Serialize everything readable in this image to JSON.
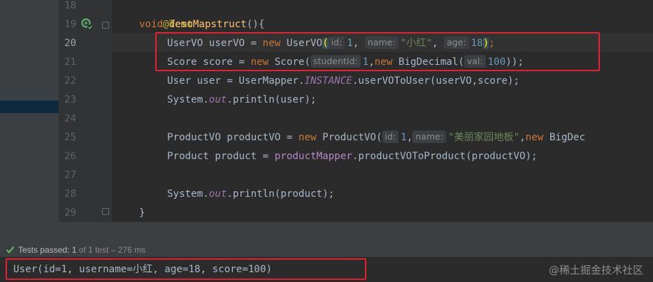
{
  "editor": {
    "lines": [
      {
        "n": "18"
      },
      {
        "n": "19"
      },
      {
        "n": "20"
      },
      {
        "n": "21"
      },
      {
        "n": "22"
      },
      {
        "n": "23"
      },
      {
        "n": "24"
      },
      {
        "n": "25"
      },
      {
        "n": "26"
      },
      {
        "n": "27"
      },
      {
        "n": "28"
      },
      {
        "n": "29"
      }
    ],
    "code": {
      "l18": {
        "annotation": "@Test"
      },
      "l19": {
        "kw": "void",
        "method": "demoMapstruct",
        "rest": "(){"
      },
      "l20": {
        "a": "UserVO userVO = ",
        "kw": "new",
        "b": " UserVO",
        "paren": "(",
        "hint1": "id:",
        "v1": "1",
        "c1": ", ",
        "hint2": "name:",
        "v2": "\"小红\"",
        "c2": ", ",
        "hint3": "age:",
        "v3": "18",
        "close": ")",
        "end": ";"
      },
      "l21": {
        "a": "Score score = ",
        "kw": "new",
        "b": " Score(",
        "hint1": "studentId:",
        "v1": "1",
        "c1": ",",
        "kw2": "new",
        "b2": " BigDecimal(",
        "hint2": "val:",
        "v2": "100",
        "end": "));"
      },
      "l22": {
        "a": "User user = UserMapper.",
        "instance": "INSTANCE",
        "b": ".userVOToUser(userVO,score);"
      },
      "l23": {
        "a": "System.",
        "out": "out",
        "b": ".println(user);"
      },
      "l25": {
        "a": "ProductVO productVO = ",
        "kw": "new",
        "b": " ProductVO(",
        "hint1": "id:",
        "v1": "1",
        "c1": ",",
        "hint2": "name:",
        "v2": "\"美丽家园地板\"",
        "c2": ",",
        "kw2": "new",
        "b2": " BigDec"
      },
      "l26": {
        "a": "Product product = ",
        "field": "productMapper",
        "b": ".productVOToProduct(productVO);"
      },
      "l28": {
        "a": "System.",
        "out": "out",
        "b": ".println(product);"
      },
      "l29": {
        "a": "}"
      }
    }
  },
  "status": {
    "label": "Tests passed:",
    "count": "1",
    "detail": "of 1 test – 276 ms"
  },
  "console": {
    "output": "User(id=1, username=小红, age=18, score=100)"
  },
  "watermark": "@稀土掘金技术社区",
  "colors": {
    "background": "#2b2b2b",
    "keyword": "#cc7832",
    "string": "#6a8759",
    "number": "#6897bb",
    "highlight_box": "#e5212f",
    "pass_green": "#5fb25f"
  },
  "icons": [
    "run-test-icon",
    "fold-icon",
    "tests-passed-check-icon"
  ]
}
